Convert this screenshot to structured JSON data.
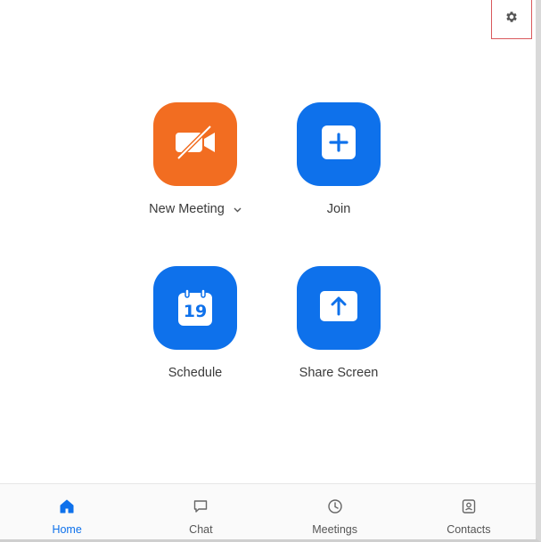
{
  "home": {
    "tiles": [
      {
        "label": "New Meeting",
        "icon": "video-off-icon",
        "color": "#f26d21",
        "has_dropdown": true
      },
      {
        "label": "Join",
        "icon": "plus-icon",
        "color": "#0e71eb"
      },
      {
        "label": "Schedule",
        "icon": "calendar-icon",
        "calendar_day": "19",
        "color": "#0e71eb"
      },
      {
        "label": "Share Screen",
        "icon": "share-up-arrow-icon",
        "color": "#0e71eb"
      }
    ]
  },
  "toolbar": {
    "settings_icon": "gear-icon"
  },
  "bottom_nav": {
    "active": "Home",
    "accent_color": "#0e71eb",
    "items": [
      {
        "label": "Home",
        "icon": "home-icon"
      },
      {
        "label": "Chat",
        "icon": "chat-bubble-icon"
      },
      {
        "label": "Meetings",
        "icon": "clock-icon"
      },
      {
        "label": "Contacts",
        "icon": "contact-card-icon"
      }
    ]
  }
}
